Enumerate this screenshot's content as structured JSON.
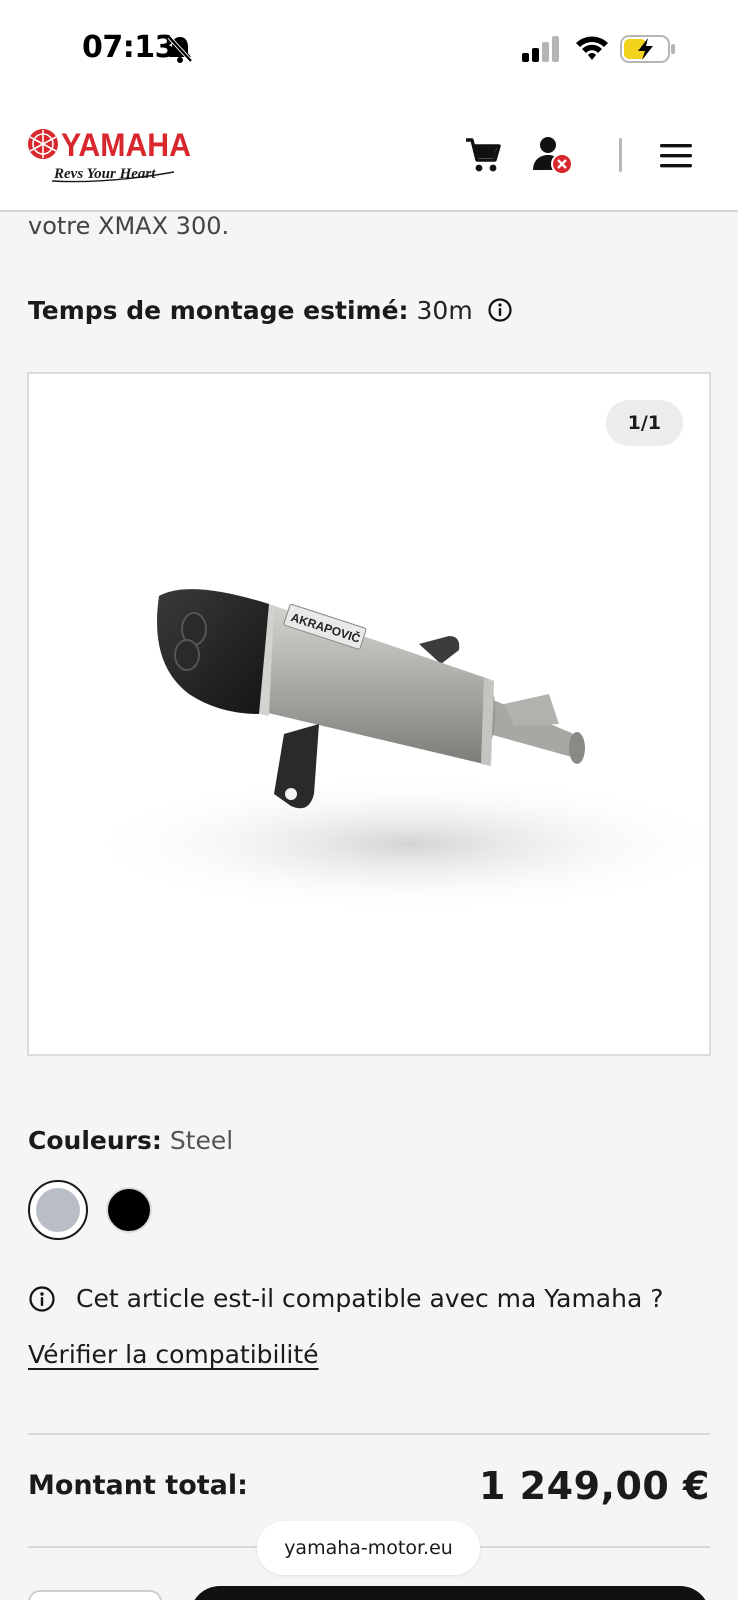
{
  "status_bar": {
    "time": "07:13",
    "icons": [
      "bell-muted-icon",
      "signal-icon",
      "wifi-icon",
      "battery-charging-icon"
    ]
  },
  "header": {
    "logo_text": "YAMAHA",
    "logo_tagline": "Revs Your Heart",
    "icons": [
      "cart-icon",
      "account-icon",
      "menu-icon"
    ]
  },
  "product": {
    "description_tail": "votre XMAX 300.",
    "mount_time_label": "Temps de montage estimé:",
    "mount_time_value": "30m",
    "gallery_counter": "1/1",
    "image_brand_text": "AKRAPOVIČ",
    "colors_label": "Couleurs:",
    "selected_color": "Steel",
    "color_swatches": [
      {
        "name": "Steel",
        "hex": "#b9bdc6",
        "selected": true
      },
      {
        "name": "Black",
        "hex": "#000000",
        "selected": false
      }
    ],
    "compat_question": "Cet article est-il compatible avec ma Yamaha ?",
    "compat_link": "Vérifier la compatibilité",
    "total_label": "Montant total:",
    "total_value": "1 249,00 €"
  },
  "browser": {
    "url": "yamaha-motor.eu"
  },
  "colors": {
    "brand_red": "#d9272e",
    "background": "#f5f5f4"
  }
}
